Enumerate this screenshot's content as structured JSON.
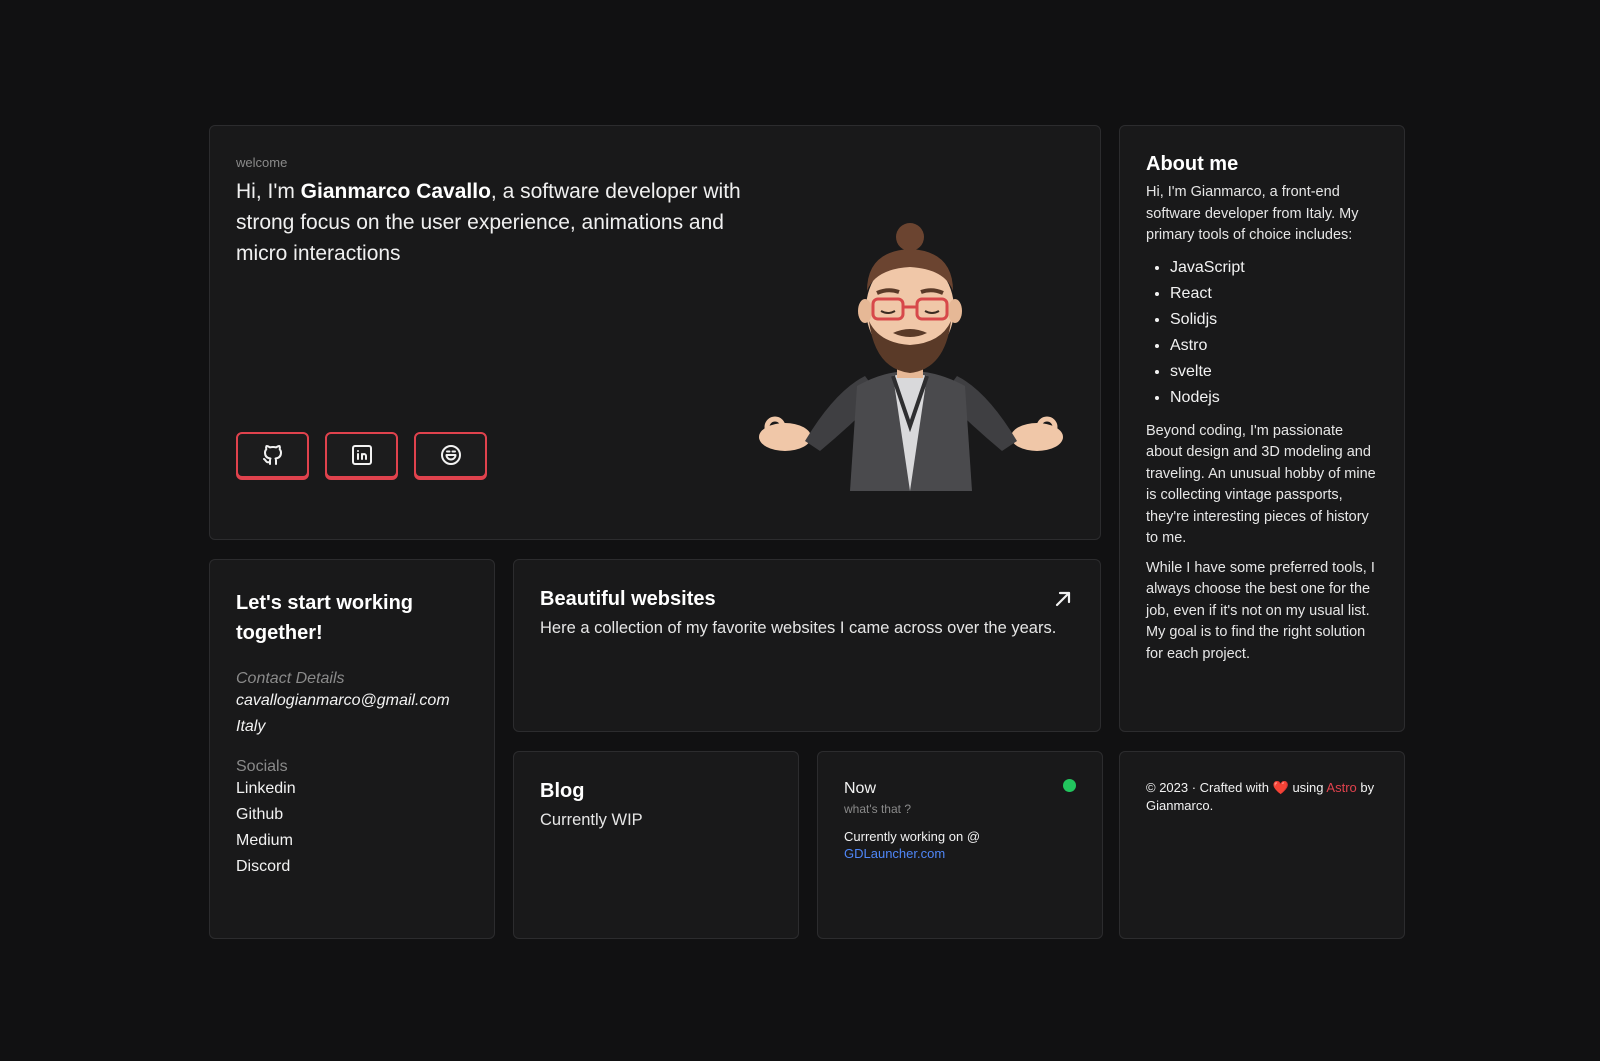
{
  "hero": {
    "welcome": "welcome",
    "intro_prefix": "Hi, I'm ",
    "intro_name": "Gianmarco Cavallo",
    "intro_suffix": ", a software developer with strong focus on the user experience, animations and micro interactions",
    "social_buttons": [
      {
        "icon": "github-icon"
      },
      {
        "icon": "linkedin-icon"
      },
      {
        "icon": "smile-icon"
      }
    ]
  },
  "about": {
    "title": "About me",
    "intro": "Hi, I'm Gianmarco, a front-end software developer from Italy. My primary tools of choice includes:",
    "tools": [
      "JavaScript",
      "React",
      "Solidjs",
      "Astro",
      "svelte",
      "Nodejs"
    ],
    "para2": "Beyond coding, I'm passionate about design and 3D modeling and traveling. An unusual hobby of mine is collecting vintage passports, they're interesting pieces of history to me.",
    "para3": "While I have some preferred tools, I always choose the best one for the job, even if it's not on my usual list. My goal is to find the right solution for each project."
  },
  "contact": {
    "title": "Let's start working together!",
    "details_label": "Contact Details",
    "email": "cavallogianmarco@gmail.com",
    "country": "Italy",
    "socials_label": "Socials",
    "socials": [
      "Linkedin",
      "Github",
      "Medium",
      "Discord"
    ]
  },
  "websites": {
    "title": "Beautiful websites",
    "description": "Here a collection of my favorite websites I came across over the years."
  },
  "blog": {
    "title": "Blog",
    "status": "Currently WIP"
  },
  "now": {
    "title": "Now",
    "subtitle": "what's that ?",
    "working_prefix": "Currently working on @",
    "working_link": "GDLauncher.com",
    "status_color": "#22c55e"
  },
  "footer": {
    "prefix": "© 2023 · Crafted with ",
    "heart": "❤️",
    "using": " using ",
    "astro": "Astro",
    "suffix": " by Gianmarco."
  }
}
